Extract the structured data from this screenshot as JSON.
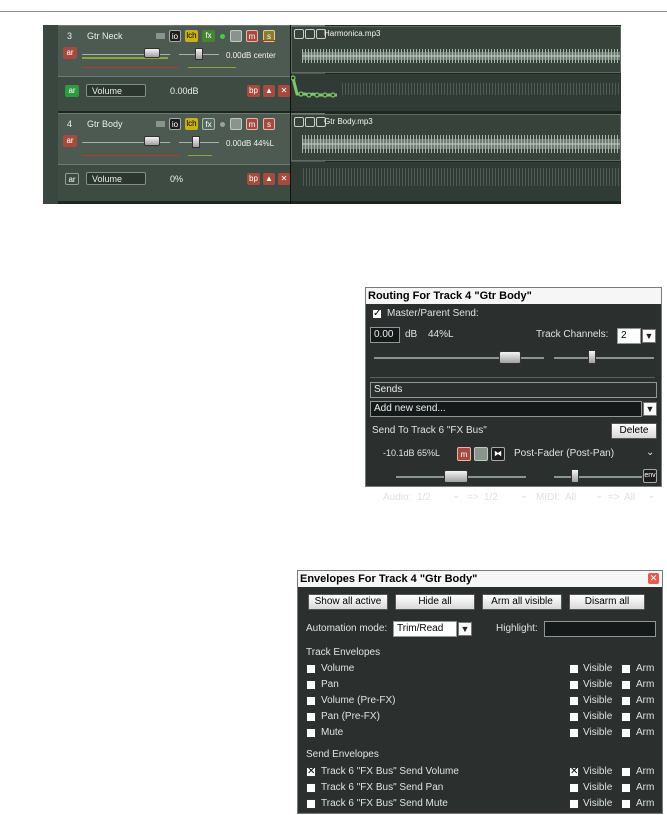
{
  "tracks": [
    {
      "number": "3",
      "name": "Gtr Neck",
      "io": "io",
      "lch": "lch",
      "fx": "fx",
      "mute": "m",
      "solo": "s",
      "arm": "ar",
      "readout": "0.00dB center",
      "item_name": "Harmonica.mp3",
      "envelope": {
        "arm": "ar",
        "name": "Volume",
        "value": "0.00dB",
        "bp": "bp",
        "up": "▲",
        "x": "✕"
      }
    },
    {
      "number": "4",
      "name": "Gtr Body",
      "io": "io",
      "lch": "lch",
      "fx": "fx",
      "mute": "m",
      "solo": "s",
      "arm": "ar",
      "readout": "0.00dB 44%L",
      "item_name": "Gtr Body.mp3",
      "envelope": {
        "arm": "ar",
        "name": "Volume",
        "value": "0%",
        "bp": "bp",
        "up": "▲",
        "x": "✕"
      }
    }
  ],
  "routing": {
    "title": "Routing For Track 4 \"Gtr Body\"",
    "master_send_label": "Master/Parent Send:",
    "master_send_checked": true,
    "volume_value": "0.00",
    "volume_unit": "dB",
    "pan_value": "44%L",
    "track_channels_label": "Track Channels:",
    "track_channels_value": "2",
    "sends_label": "Sends",
    "add_send_placeholder": "Add new send...",
    "send_title": "Send To Track 6 \"FX Bus\"",
    "delete_label": "Delete",
    "send_readout": "-10.1dB 65%L",
    "send_mute": "m",
    "send_mode": "Post-Fader (Post-Pan)",
    "env_label": "env",
    "audio_label": "Audio:",
    "audio_src": "1/2",
    "audio_arrow": "=>",
    "audio_dst": "1/2",
    "midi_label": "MIDI:",
    "midi_src": "All",
    "midi_arrow": "=>",
    "midi_dst": "All"
  },
  "envelopes": {
    "title": "Envelopes For Track 4 \"Gtr Body\"",
    "buttons": {
      "show_all_active": "Show all active",
      "hide_all": "Hide all",
      "arm_all_visible": "Arm all visible",
      "disarm_all": "Disarm all"
    },
    "automation_mode_label": "Automation mode:",
    "automation_mode_value": "Trim/Read",
    "highlight_label": "Highlight:",
    "highlight_value": "",
    "track_envelopes_heading": "Track Envelopes",
    "track_envelopes": [
      {
        "name": "Volume",
        "checked": false,
        "visible_label": "Visible",
        "visible": false,
        "arm_label": "Arm",
        "arm": false
      },
      {
        "name": "Pan",
        "checked": false,
        "visible_label": "Visible",
        "visible": false,
        "arm_label": "Arm",
        "arm": false
      },
      {
        "name": "Volume (Pre-FX)",
        "checked": false,
        "visible_label": "Visible",
        "visible": false,
        "arm_label": "Arm",
        "arm": false
      },
      {
        "name": "Pan (Pre-FX)",
        "checked": false,
        "visible_label": "Visible",
        "visible": false,
        "arm_label": "Arm",
        "arm": false
      },
      {
        "name": "Mute",
        "checked": false,
        "visible_label": "Visible",
        "visible": false,
        "arm_label": "Arm",
        "arm": false
      }
    ],
    "send_envelopes_heading": "Send Envelopes",
    "send_envelopes": [
      {
        "name": "Track 6 \"FX Bus\" Send Volume",
        "checked": true,
        "visible_label": "Visible",
        "visible": true,
        "arm_label": "Arm",
        "arm": false
      },
      {
        "name": "Track 6 \"FX Bus\" Send Pan",
        "checked": false,
        "visible_label": "Visible",
        "visible": false,
        "arm_label": "Arm",
        "arm": false
      },
      {
        "name": "Track 6 \"FX Bus\" Send Mute",
        "checked": false,
        "visible_label": "Visible",
        "visible": false,
        "arm_label": "Arm",
        "arm": false
      }
    ]
  }
}
